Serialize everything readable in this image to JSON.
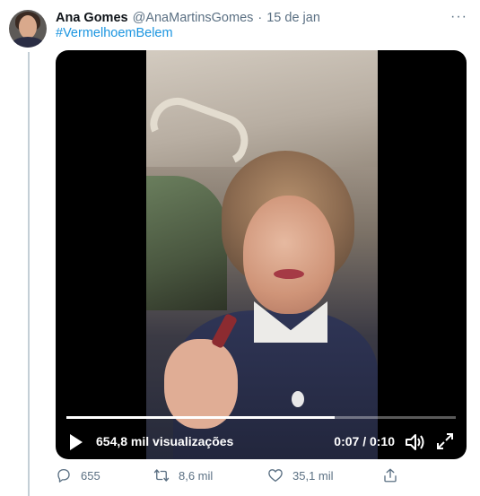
{
  "tweet": {
    "author_name": "Ana Gomes",
    "handle": "@AnaMartinsGomes",
    "separator": "·",
    "date": "15 de jan",
    "more_label": "···",
    "hashtag": "#VermelhoemBelem"
  },
  "video": {
    "views": "654,8 mil visualizações",
    "time": "0:07 / 0:10",
    "progress": 0.69
  },
  "actions": {
    "replies": "655",
    "retweets": "8,6 mil",
    "likes": "35,1 mil"
  },
  "colors": {
    "link": "#1b95e0",
    "secondary_text": "#5b7083",
    "thread_line": "#c4cfd6"
  },
  "icons": [
    "reply-icon",
    "retweet-icon",
    "like-icon",
    "share-icon",
    "play-icon",
    "volume-icon",
    "fullscreen-icon",
    "more-icon"
  ]
}
